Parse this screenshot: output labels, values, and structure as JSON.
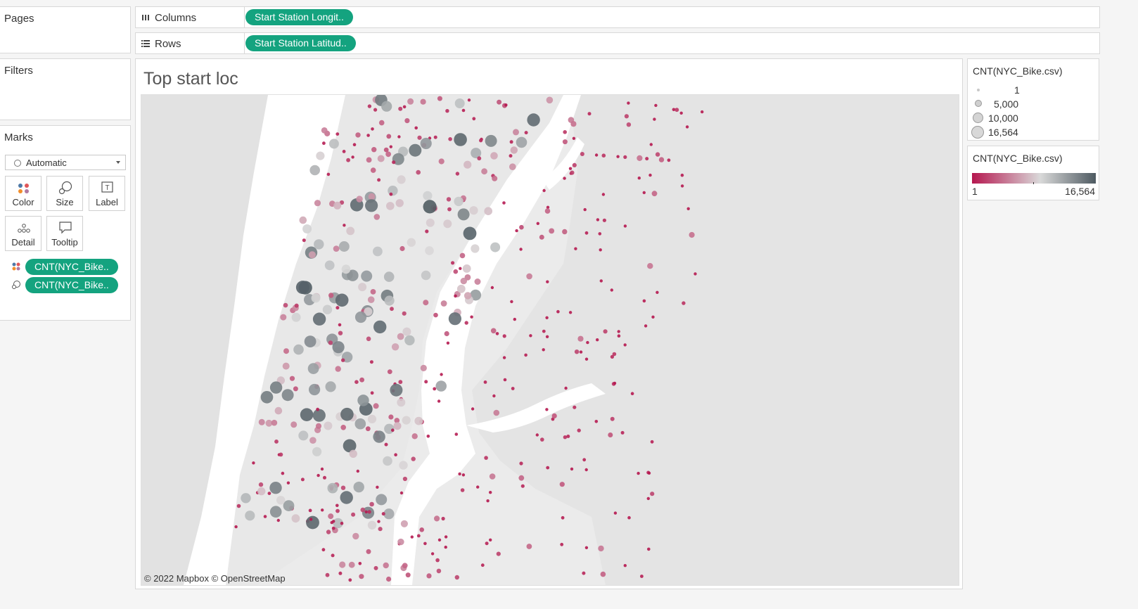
{
  "left_panel": {
    "pages_title": "Pages",
    "filters_title": "Filters",
    "marks_title": "Marks",
    "mark_type": "Automatic",
    "mark_buttons": {
      "color": "Color",
      "size": "Size",
      "label": "Label",
      "detail": "Detail",
      "tooltip": "Tooltip"
    },
    "mark_pills": [
      "CNT(NYC_Bike..",
      "CNT(NYC_Bike.."
    ]
  },
  "shelves": {
    "columns_label": "Columns",
    "columns_pill": "Start Station Longit..",
    "rows_label": "Rows",
    "rows_pill": "Start Station Latitud.."
  },
  "worksheet": {
    "title": "Top start loc",
    "attribution": "© 2022 Mapbox © OpenStreetMap"
  },
  "legends": {
    "size_title": "CNT(NYC_Bike.csv)",
    "size_entries": [
      "1",
      "5,000",
      "10,000",
      "16,564"
    ],
    "color_title": "CNT(NYC_Bike.csv)",
    "color_min": "1",
    "color_max": "16,564",
    "color_low": "#b5174f",
    "color_mid": "#d9d9d9",
    "color_high": "#4e5a61"
  }
}
